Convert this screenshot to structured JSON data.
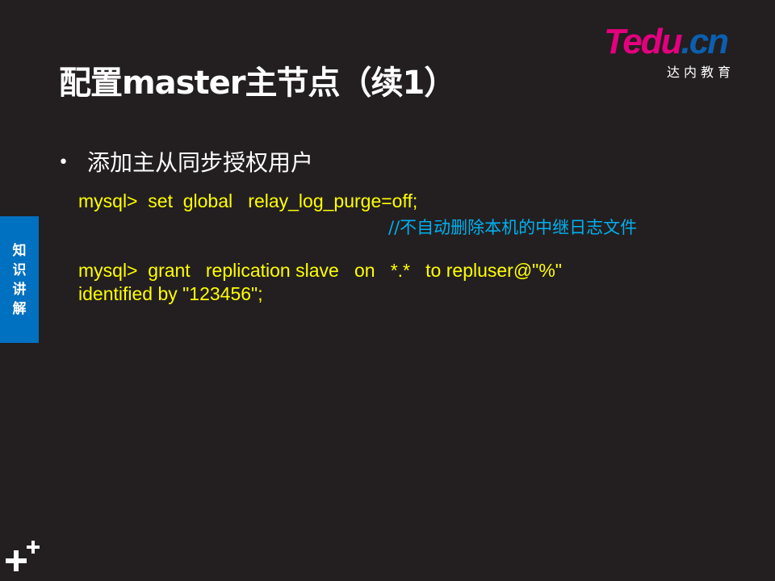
{
  "slide": {
    "title": "配置master主节点（续1）",
    "logo": {
      "word_part1": "Tedu",
      "word_part2": ".cn",
      "subtitle": "达内教育"
    },
    "side_tab": {
      "chars": [
        "知",
        "识",
        "讲",
        "解"
      ]
    },
    "bullet": "添加主从同步授权用户",
    "code_lines": [
      "mysql>  set  global   relay_log_purge=off;",
      "mysql>  grant   replication slave   on   *.*   to repluser@\"%\"",
      "identified by \"123456\";"
    ],
    "comment": "//不自动删除本机的中继日志文件",
    "colors": {
      "background": "#231f20",
      "code": "#ffff00",
      "comment": "#00b0f0",
      "side_tab": "#0070c0",
      "brand_pink": "#e4007f",
      "brand_blue": "#0b5fb0"
    },
    "icons": {
      "corner": "plus-icon"
    }
  }
}
